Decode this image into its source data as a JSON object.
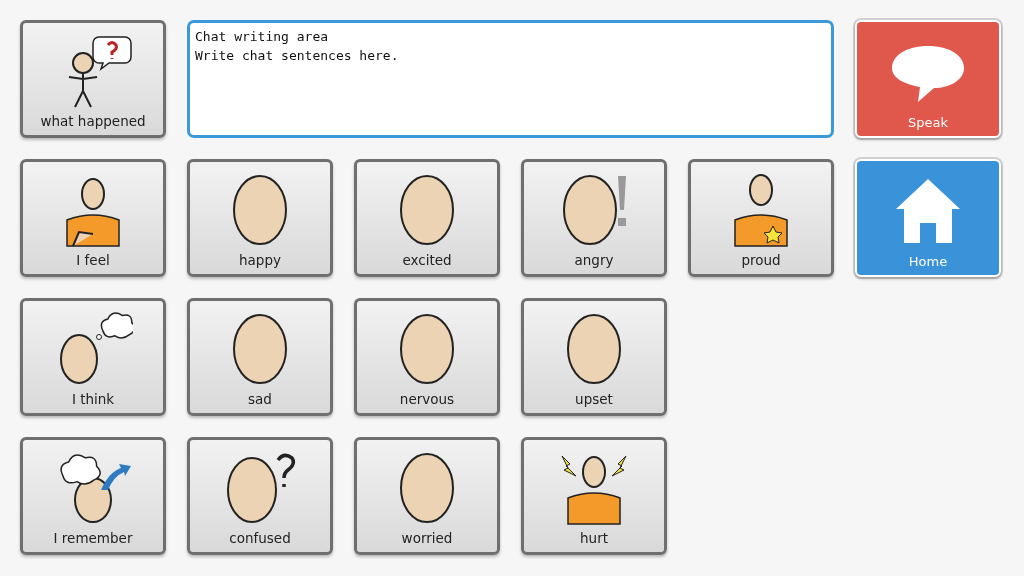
{
  "top_row": {
    "symbol": {
      "label": "what happened",
      "kind": "figure-question"
    },
    "chat_area": {
      "value": "Chat writing area\nWrite chat sentences here."
    },
    "speak_button": {
      "label": "Speak",
      "kind": "speech",
      "color": "#e0584c"
    }
  },
  "rows": [
    [
      {
        "label": "I feel",
        "kind": "figure"
      },
      {
        "label": "happy",
        "kind": "face"
      },
      {
        "label": "excited",
        "kind": "face"
      },
      {
        "label": "angry",
        "kind": "face-exclaim"
      },
      {
        "label": "proud",
        "kind": "figure-star"
      },
      {
        "label": "Home",
        "kind": "home",
        "color": "#3a92d8"
      }
    ],
    [
      {
        "label": "I think",
        "kind": "face-thought"
      },
      {
        "label": "sad",
        "kind": "face"
      },
      {
        "label": "nervous",
        "kind": "face"
      },
      {
        "label": "upset",
        "kind": "face"
      }
    ],
    [
      {
        "label": "I remember",
        "kind": "face-thought-arrow"
      },
      {
        "label": "confused",
        "kind": "face-question"
      },
      {
        "label": "worried",
        "kind": "face"
      },
      {
        "label": "hurt",
        "kind": "figure-lightning"
      }
    ]
  ]
}
